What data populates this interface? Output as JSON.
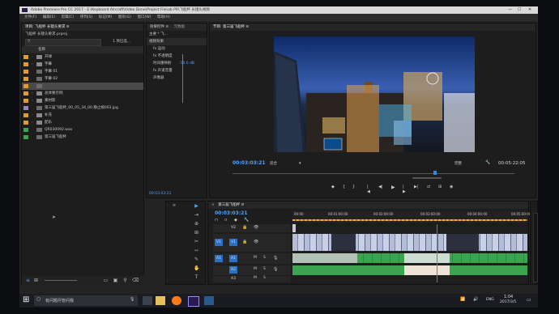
{
  "app_title": "Adobe Premiere Pro CC 2017 - E:\\Keyboard Aircraft\\Video Done\\Project File\\ab PR\\飞船杯 长镜头视频",
  "window_controls": {
    "minimize": "—",
    "maximize": "☐",
    "close": "✕"
  },
  "menu": [
    "文件(F)",
    "编辑(E)",
    "剪辑(C)",
    "序列(S)",
    "标记(M)",
    "图形(G)",
    "窗口(W)",
    "帮助(H)"
  ],
  "project_panel": {
    "header": "项目: 飞船杯 长镜头要求 ≡",
    "project_file": "飞船杯 长镜头要求.prproj",
    "search_placeholder": "",
    "items_count": "1 项已选...",
    "column_name": "名称",
    "items": [
      {
        "label": "开球",
        "color": "#e39a2f",
        "kind": "folder"
      },
      {
        "label": "字幕",
        "color": "#e39a2f",
        "kind": "folder"
      },
      {
        "label": "字幕 01",
        "color": "#e39a2f",
        "kind": "item"
      },
      {
        "label": "字幕 02",
        "color": "#e39a2f",
        "kind": "item"
      },
      {
        "label": "",
        "color": "#e39a2f",
        "kind": "item"
      },
      {
        "label": "总体要示例",
        "color": "#e39a2f",
        "kind": "folder"
      },
      {
        "label": "素材影",
        "color": "#e39a2f",
        "kind": "folder"
      },
      {
        "label": "第三届飞船杯_00_05_34_00.静止帧003.jpg",
        "color": "#9b7fbf",
        "kind": "item"
      },
      {
        "label": "补充",
        "color": "#e39a2f",
        "kind": "folder"
      },
      {
        "label": "配乐",
        "color": "#e39a2f",
        "kind": "folder"
      },
      {
        "label": "QR030092.wav",
        "color": "#3aa44f",
        "kind": "item"
      },
      {
        "label": "第三届飞船杯",
        "color": "#3aa44f",
        "kind": "item"
      }
    ]
  },
  "effects_panel": {
    "tabs": [
      "效果控件 ≡",
      "元数据"
    ],
    "source": "主要 * 飞...",
    "rows": [
      "视频效果",
      "fx 运动",
      "fx 不透明度",
      "时间重映射",
      "fx 声道音量",
      "声像器"
    ],
    "value": "-10.0 dB",
    "timecode": "00:03:03:21"
  },
  "program_monitor": {
    "title": "节目: 第三届飞船杯 ≡",
    "timecode": "00:03:03:21",
    "fit": "适合",
    "quality": "完整",
    "duration": "00:05:22:05",
    "transport": [
      "◆",
      "{",
      "}",
      "|◀",
      "◀|",
      "▶",
      "|▶",
      "▶|",
      "⇄",
      "⊞",
      "◉"
    ]
  },
  "timeline": {
    "title": "第三届飞船杯 ≡",
    "timecode": "00:03:03:21",
    "ruler": [
      "00:00",
      "00:01:00:00",
      "00:02:00:00",
      "00:03:00:00",
      "00:04:00:00",
      "00:05:00:00"
    ],
    "tracks": [
      "V2",
      "V1",
      "A1",
      "A2",
      "A3"
    ],
    "source_patch": [
      "V1",
      "A1"
    ]
  },
  "tools": [
    "▶",
    "⇥",
    "⊕",
    "⊞",
    "✂",
    "⇿",
    "✎",
    "✋",
    "T"
  ],
  "taskbar": {
    "search": "有问题尽管问我",
    "time": "1:04",
    "date": "2017/3/5",
    "lang": "ENG"
  },
  "colors": {
    "accent": "#2d8ceb",
    "label_orange": "#e39a2f",
    "label_green": "#3aa44f",
    "video_clip": "#9aa6c8",
    "audio_clip": "#3aa44f"
  }
}
